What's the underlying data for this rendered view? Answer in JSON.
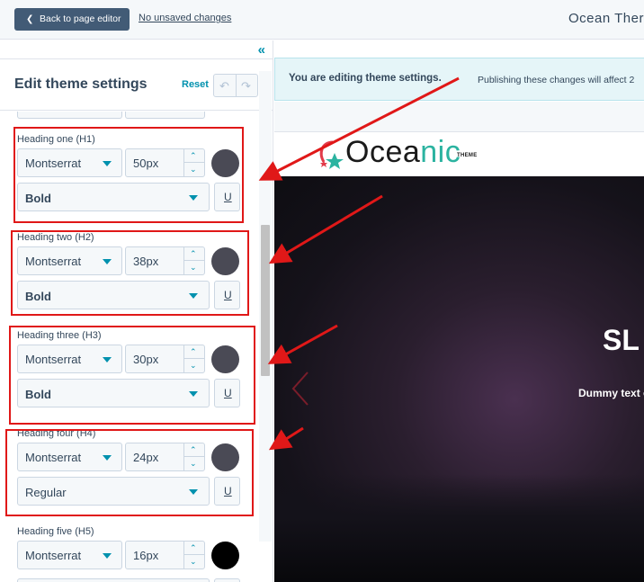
{
  "topbar": {
    "back_label": "Back to page editor",
    "unsaved_label": "No unsaved changes",
    "site_title": "Ocean Ther"
  },
  "panel": {
    "title": "Edit theme settings",
    "reset_label": "Reset"
  },
  "headings": [
    {
      "label": "Heading one (H1)",
      "font": "Montserrat",
      "size": "50px",
      "weight": "Bold",
      "color": "#4a4a55"
    },
    {
      "label": "Heading two (H2)",
      "font": "Montserrat",
      "size": "38px",
      "weight": "Bold",
      "color": "#4a4a55"
    },
    {
      "label": "Heading three (H3)",
      "font": "Montserrat",
      "size": "30px",
      "weight": "Bold",
      "color": "#4a4a55"
    },
    {
      "label": "Heading four (H4)",
      "font": "Montserrat",
      "size": "24px",
      "weight": "Regular",
      "color": "#4a4a55"
    },
    {
      "label": "Heading five (H5)",
      "font": "Montserrat",
      "size": "16px",
      "weight": "",
      "color": "#000000"
    }
  ],
  "underline_glyph": "U",
  "preview": {
    "banner_bold": "You are editing theme settings.",
    "banner_text": "Publishing these changes will affect 2",
    "logo_main": "Ocea",
    "logo_accent": "nic",
    "logo_tag": "THEME",
    "hero_title": "SL",
    "hero_subtitle": "Dummy text o"
  },
  "colors": {
    "accent": "#0091ae",
    "back_button": "#425b76",
    "highlight": "#e01818"
  }
}
